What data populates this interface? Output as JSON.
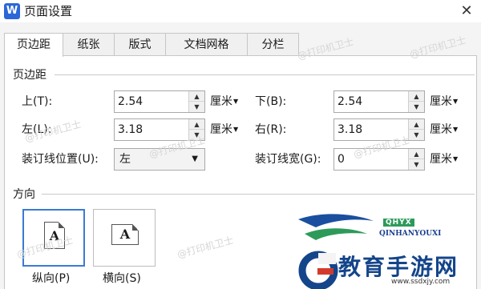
{
  "window": {
    "app_icon_letter": "W",
    "title": "页面设置",
    "close_glyph": "✕"
  },
  "tabs": [
    {
      "label": "页边距",
      "active": true
    },
    {
      "label": "纸张",
      "active": false
    },
    {
      "label": "版式",
      "active": false
    },
    {
      "label": "文档网格",
      "active": false
    },
    {
      "label": "分栏",
      "active": false
    }
  ],
  "margins": {
    "section_title": "页边距",
    "top": {
      "label": "上(T):",
      "value": "2.54",
      "unit": "厘米"
    },
    "bottom": {
      "label": "下(B):",
      "value": "2.54",
      "unit": "厘米"
    },
    "left": {
      "label": "左(L):",
      "value": "3.18",
      "unit": "厘米"
    },
    "right": {
      "label": "右(R):",
      "value": "3.18",
      "unit": "厘米"
    },
    "gutter_position": {
      "label": "装订线位置(U):",
      "value": "左"
    },
    "gutter_width": {
      "label": "装订线宽(G):",
      "value": "0",
      "unit": "厘米"
    }
  },
  "orientation": {
    "section_title": "方向",
    "portrait": {
      "label": "纵向(P)",
      "icon_letter": "A",
      "selected": true
    },
    "landscape": {
      "label": "横向(S)",
      "icon_letter": "A",
      "selected": false
    }
  },
  "watermark": {
    "text": "@打印机卫士"
  },
  "brand": {
    "tag": "QHYX",
    "english": "QINHANYOUXI",
    "chinese": "教育手游网",
    "url": "www.ssdxjy.com"
  },
  "colors": {
    "accent": "#3a7bd5",
    "app_icon": "#2b67d8",
    "brand_blue": "#14458a",
    "brand_green": "#2d9a5a"
  }
}
